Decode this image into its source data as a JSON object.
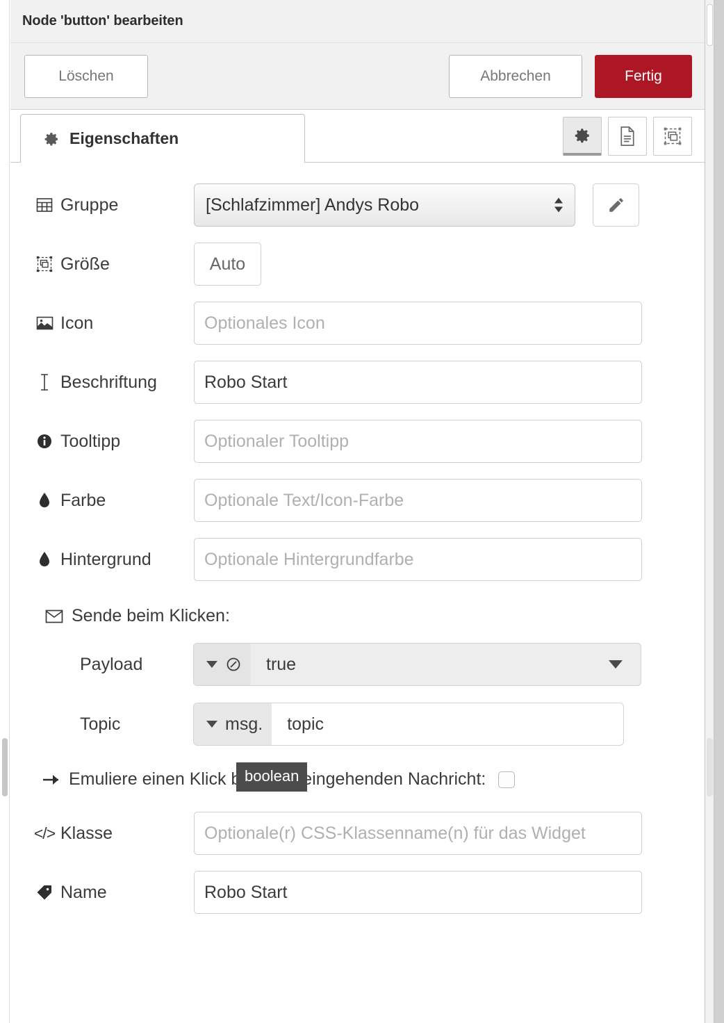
{
  "dialog": {
    "title": "Node 'button' bearbeiten",
    "buttons": {
      "delete": "Löschen",
      "cancel": "Abbrechen",
      "done": "Fertig"
    },
    "accent_color": "#ad1625"
  },
  "tabs": {
    "active_label": "Eigenschaften",
    "icon_buttons": [
      {
        "name": "gear-icon",
        "active": true
      },
      {
        "name": "description-icon",
        "active": false
      },
      {
        "name": "appearance-icon",
        "active": false
      }
    ]
  },
  "form": {
    "group": {
      "label": "Gruppe",
      "icon": "table-icon",
      "value": "[Schlafzimmer] Andys Robo",
      "edit_button": "pencil-icon"
    },
    "size": {
      "label": "Größe",
      "icon": "resize-icon",
      "value": "Auto"
    },
    "icon_field": {
      "label": "Icon",
      "icon": "image-icon",
      "value": "",
      "placeholder": "Optionales Icon"
    },
    "caption": {
      "label": "Beschriftung",
      "icon": "text-cursor-icon",
      "value": "Robo Start",
      "placeholder": ""
    },
    "tooltip_field": {
      "label": "Tooltipp",
      "icon": "info-icon",
      "value": "",
      "placeholder": "Optionaler Tooltipp"
    },
    "color": {
      "label": "Farbe",
      "icon": "droplet-icon",
      "value": "",
      "placeholder": "Optionale Text/Icon-Farbe"
    },
    "background": {
      "label": "Hintergrund",
      "icon": "droplet-icon",
      "value": "",
      "placeholder": "Optionale Hintergrundfarbe"
    }
  },
  "send_section": {
    "heading": "Sende beim Klicken:",
    "heading_icon": "envelope-icon",
    "payload": {
      "label": "Payload",
      "type_icon": "boolean-icon",
      "value": "true"
    },
    "topic": {
      "label": "Topic",
      "type_prefix": "msg.",
      "value": "topic"
    },
    "tooltip_text": "boolean"
  },
  "emulate": {
    "label": "Emuliere einen Klick bei einer eingehenden Nachricht:",
    "icon": "arrow-right-icon",
    "checked": false
  },
  "class_field": {
    "label": "Klasse",
    "icon": "code-icon",
    "value": "",
    "placeholder": "Optionale(r) CSS-Klassenname(n) für das Widget"
  },
  "name_field": {
    "label": "Name",
    "icon": "tag-icon",
    "value": "Robo Start",
    "placeholder": ""
  }
}
